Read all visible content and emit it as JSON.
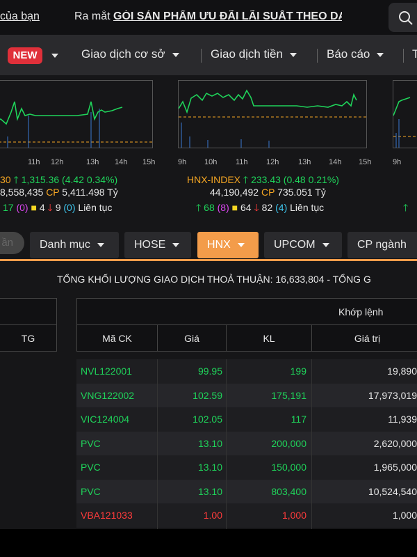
{
  "ticker": {
    "text1": "của bạn",
    "text2_prefix": "Ra mắt ",
    "text2_highlight": "GÓI SẢN PHẨM ƯU ĐÃI LÃI SUẤT THEO DA"
  },
  "nav": {
    "badge": "NEW",
    "items": [
      "Giao dịch cơ sở",
      "Giao dịch tiền",
      "Báo cáo",
      "T"
    ]
  },
  "time_ticks": {
    "left": [
      "11h",
      "12h",
      "13h",
      "14h",
      "15h"
    ],
    "middle": [
      "9h",
      "10h",
      "11h",
      "12h",
      "13h",
      "14h",
      "15h"
    ],
    "right": [
      "9h"
    ]
  },
  "index_left": {
    "line1_prefix": "30",
    "line1_value": "1,315.36 (4.42 0.34%)",
    "line2_volume": "8,558,435",
    "line2_cp": "CP",
    "line2_value": "5,411.498 Tỷ",
    "line3_up": "17",
    "line3_up_ceiling": "(0)",
    "line3_flat": "4",
    "line3_down": "9",
    "line3_down_floor": "(0)",
    "line3_status": "Liên tục"
  },
  "index_middle": {
    "name": "HNX-INDEX",
    "value": "233.43 (0.48 0.21%)",
    "volume": "44,190,492",
    "cp": "CP",
    "cp_value": "735.051 Tỷ",
    "up": "68",
    "up_ceiling": "(8)",
    "flat": "64",
    "down": "82",
    "down_floor": "(4)",
    "status": "Liên tục"
  },
  "tabs": {
    "pill": "ần",
    "items": [
      "Danh mục",
      "HOSE",
      "HNX",
      "UPCOM",
      "CP ngành"
    ],
    "active": "HNX"
  },
  "summary": "TỔNG KHỐI LƯỢNG GIAO DỊCH THOẢ THUẬN: 16,633,804  -  TỔNG G",
  "left_table": {
    "header": "TG"
  },
  "table": {
    "group_header": "Khớp lệnh",
    "columns": [
      "Mã CK",
      "Giá",
      "KL",
      "Giá trị"
    ],
    "rows": [
      {
        "ma": "NVL122001",
        "gia": "99.95",
        "kl": "199",
        "gt": "19,890",
        "color": "#1fd35a"
      },
      {
        "ma": "VNG122002",
        "gia": "102.59",
        "kl": "175,191",
        "gt": "17,973,019",
        "color": "#1fd35a"
      },
      {
        "ma": "VIC124004",
        "gia": "102.05",
        "kl": "117",
        "gt": "11,939",
        "color": "#1fd35a"
      },
      {
        "ma": "PVC",
        "gia": "13.10",
        "kl": "200,000",
        "gt": "2,620,000",
        "color": "#1fd35a"
      },
      {
        "ma": "PVC",
        "gia": "13.10",
        "kl": "150,000",
        "gt": "1,965,000",
        "color": "#1fd35a"
      },
      {
        "ma": "PVC",
        "gia": "13.10",
        "kl": "803,400",
        "gt": "10,524,540",
        "color": "#1fd35a"
      },
      {
        "ma": "VBA121033",
        "gia": "1.00",
        "kl": "1,000",
        "gt": "1,000",
        "color": "#ff3b3b"
      }
    ]
  },
  "colors": {
    "accent": "#f39c4a",
    "up": "#1fd35a",
    "down": "#ff3b3b",
    "reference": "#f5a623",
    "ceiling": "#d946ef",
    "floor": "#3ec7f0"
  }
}
